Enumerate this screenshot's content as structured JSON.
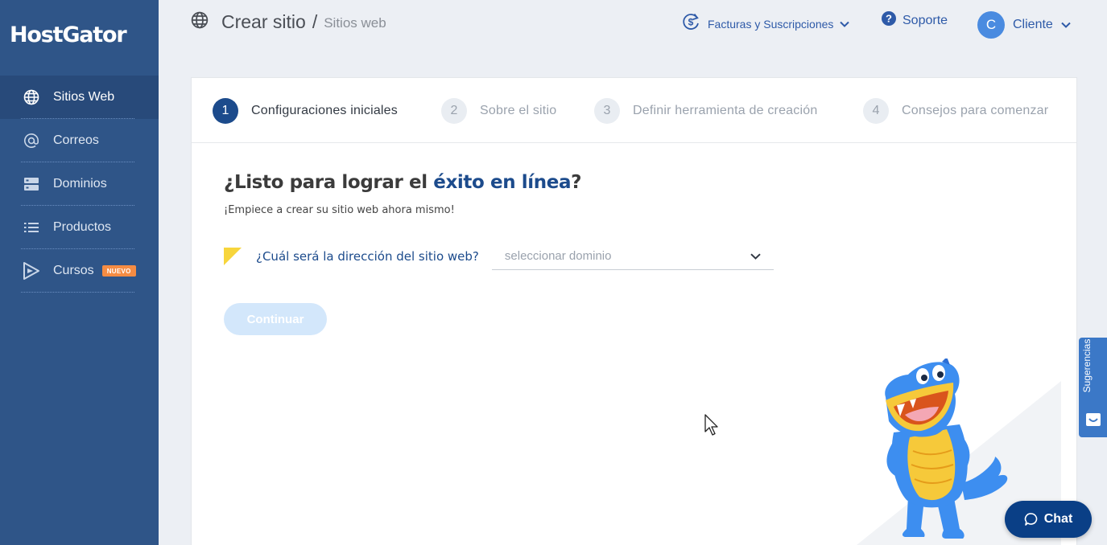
{
  "sidebar": {
    "logo": "HostGator",
    "items": [
      {
        "label": "Sitios Web",
        "icon": "globe-icon",
        "active": true
      },
      {
        "label": "Correos",
        "icon": "at-sign-icon"
      },
      {
        "label": "Dominios",
        "icon": "server-icon"
      },
      {
        "label": "Productos",
        "icon": "list-icon"
      },
      {
        "label": "Cursos",
        "icon": "play-icon",
        "badge": "NUEVO"
      }
    ]
  },
  "header": {
    "title": "Crear sitio",
    "separator": "/",
    "subtitle": "Sitios web",
    "billing": "Facturas y Suscripciones",
    "support": "Soporte",
    "avatar_initial": "C",
    "user": "Cliente"
  },
  "steps": [
    {
      "num": "1",
      "label": "Configuraciones iniciales",
      "active": true
    },
    {
      "num": "2",
      "label": "Sobre el sitio"
    },
    {
      "num": "3",
      "label": "Definir herramienta de creación"
    },
    {
      "num": "4",
      "label": "Consejos para comenzar"
    }
  ],
  "main": {
    "headline_pre": "¿Listo para lograr el ",
    "headline_highlight": "éxito en línea",
    "headline_post": "?",
    "subline": "¡Empiece a crear su sitio web ahora mismo!",
    "question": "¿Cuál será la dirección del sitio web?",
    "select_placeholder": "seleccionar dominio",
    "continue_label": "Continuar"
  },
  "feedback_tab": "Sugerencias",
  "chat_label": "Chat",
  "colors": {
    "sidebar": "#2f5588",
    "primary": "#1c4b8c",
    "accent_orange": "#f58c43",
    "flag_yellow": "#f7d53c",
    "chat": "#0a3f86"
  }
}
